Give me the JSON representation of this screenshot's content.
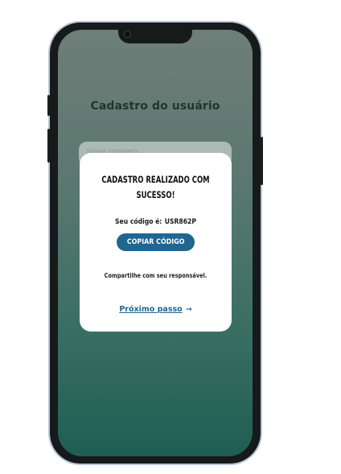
{
  "screen": {
    "page_title": "Cadastro do usuário",
    "behind_field_placeholder": "Nome completo"
  },
  "modal": {
    "title_line1": "CADASTRO REALIZADO COM",
    "title_line2": "SUCESSO!",
    "code_label": "Seu código é:",
    "code_value": "USR862P",
    "copy_button_label": "COPIAR CÓDIGO",
    "share_text": "Compartilhe com seu responsável.",
    "next_link_label": "Próximo passo",
    "next_link_arrow": "→"
  },
  "colors": {
    "accent": "#1f6690",
    "screen_top": "#6f7e78",
    "screen_bottom": "#1f5e53",
    "frame": "#161a1a"
  },
  "icons": {
    "camera": "camera-icon",
    "arrow": "arrow-right-icon"
  }
}
